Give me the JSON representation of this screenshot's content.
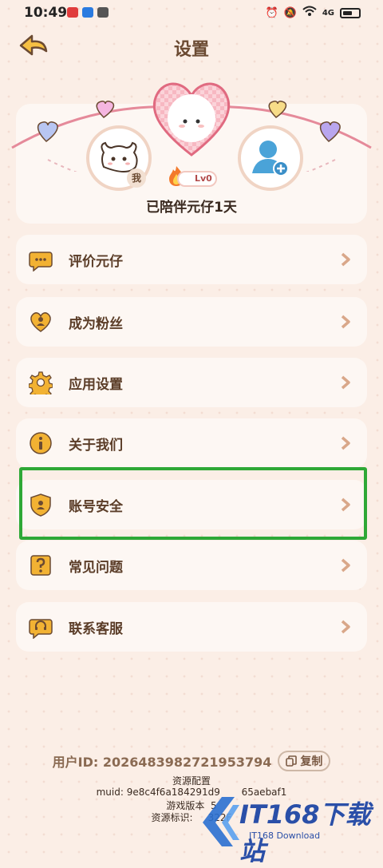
{
  "status_bar": {
    "time": "10:49",
    "network": "4G"
  },
  "header": {
    "title": "设置"
  },
  "profile": {
    "me_badge": "我",
    "level": "Lv0",
    "companion_text": "已陪伴元仔1天"
  },
  "menu": [
    {
      "label": "评价元仔",
      "icon": "chat-icon"
    },
    {
      "label": "成为粉丝",
      "icon": "heart-user-icon"
    },
    {
      "label": "应用设置",
      "icon": "gear-icon"
    },
    {
      "label": "关于我们",
      "icon": "info-icon"
    },
    {
      "label": "账号安全",
      "icon": "shield-icon"
    },
    {
      "label": "常见问题",
      "icon": "question-icon"
    },
    {
      "label": "联系客服",
      "icon": "headset-icon"
    }
  ],
  "footer": {
    "user_id": "用户ID: 2026483982721953794",
    "copy_label": "复制",
    "resource_config": "资源配置",
    "muid": "muid: 9e8c4f6a184291d9",
    "muid_tail": "65aebaf1",
    "game_version": "游戏版本",
    "game_version_tail": "5",
    "resource_id": "资源标识:",
    "resource_id_tail": "322F"
  },
  "watermark": {
    "text": "IT168下载站",
    "sub": "IT168 Download"
  },
  "colors": {
    "accent_brown": "#6b4a32",
    "icon_gold": "#f2b233",
    "highlight_green": "#2ea836"
  }
}
